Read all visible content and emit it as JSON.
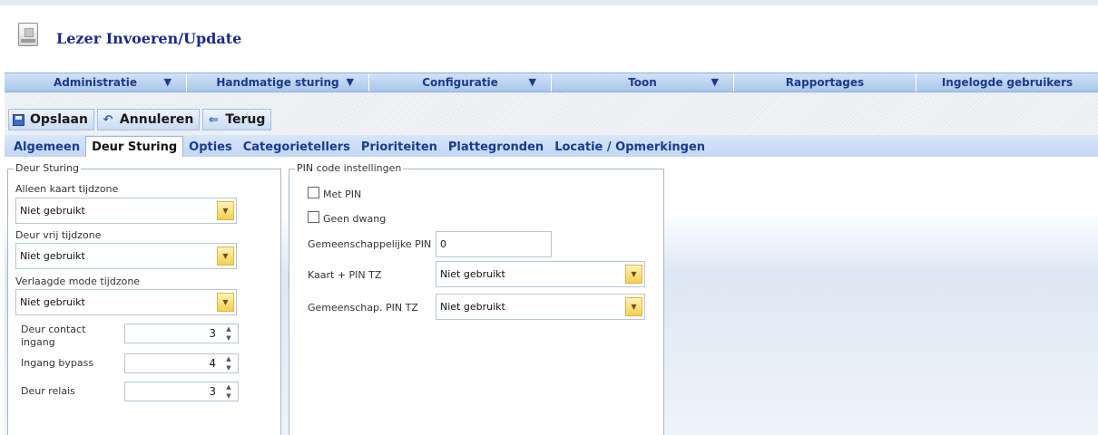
{
  "header": {
    "title": "Lezer Invoeren/Update"
  },
  "menu": [
    {
      "label": "Administratie",
      "has_arrow": true
    },
    {
      "label": "Handmatige sturing",
      "has_arrow": true
    },
    {
      "label": "Configuratie",
      "has_arrow": true
    },
    {
      "label": "Toon",
      "has_arrow": true
    },
    {
      "label": "Rapportages",
      "has_arrow": false
    },
    {
      "label": "Ingelogde gebruikers",
      "has_arrow": false
    }
  ],
  "menu_arrow": "▼",
  "toolbar": {
    "save_label": "Opslaan",
    "cancel_label": "Annuleren",
    "back_label": "Terug"
  },
  "tabs": [
    {
      "label": "Algemeen",
      "active": false
    },
    {
      "label": "Deur Sturing",
      "active": true
    },
    {
      "label": "Opties",
      "active": false
    },
    {
      "label": "Categorietellers",
      "active": false
    },
    {
      "label": "Prioriteiten",
      "active": false
    },
    {
      "label": "Plattegronden",
      "active": false
    },
    {
      "label": "Locatie / Opmerkingen",
      "active": false
    }
  ],
  "door": {
    "legend": "Deur Sturing",
    "card_only_tz": {
      "label": "Alleen kaart tijdzone",
      "value": "Niet gebruikt"
    },
    "door_free_tz": {
      "label": "Deur vrij tijdzone",
      "value": "Niet gebruikt"
    },
    "reduced_mode_tz": {
      "label": "Verlaagde mode tijdzone",
      "value": "Niet gebruikt"
    },
    "contact_input": {
      "label_line1": "Deur contact",
      "label_line2": "ingang",
      "value": "3"
    },
    "bypass_input": {
      "label": "Ingang bypass",
      "value": "4"
    },
    "relay": {
      "label": "Deur relais",
      "value": "3"
    }
  },
  "pin": {
    "legend": "PIN code instellingen",
    "with_pin": {
      "label": "Met PIN",
      "checked": false
    },
    "no_duress": {
      "label": "Geen dwang",
      "checked": false
    },
    "common_pin": {
      "label": "Gemeenschappelijke PIN",
      "value": "0"
    },
    "card_pin_tz": {
      "label": "Kaart + PIN TZ",
      "value": "Niet gebruikt"
    },
    "common_pin_tz": {
      "label": "Gemeenschap. PIN TZ",
      "value": "Niet gebruikt"
    }
  },
  "colors": {
    "title": "#1a2a8a",
    "menu_text": "#1b3a8c",
    "combo_button": "#f5cf52"
  }
}
